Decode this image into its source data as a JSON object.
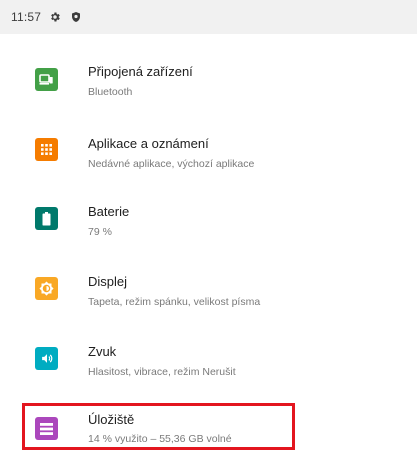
{
  "status_bar": {
    "time": "11:57",
    "icons": [
      "gear-icon",
      "shield-icon"
    ]
  },
  "settings": {
    "items": [
      {
        "title": "Připojená zařízení",
        "subtitle": "Bluetooth",
        "icon": "connected-devices-icon",
        "color": "#43a047"
      },
      {
        "title": "Aplikace a oznámení",
        "subtitle": "Nedávné aplikace, výchozí aplikace",
        "icon": "apps-grid-icon",
        "color": "#f57c00"
      },
      {
        "title": "Baterie",
        "subtitle": "79 %",
        "icon": "battery-icon",
        "color": "#00796b"
      },
      {
        "title": "Displej",
        "subtitle": "Tapeta, režim spánku, velikost písma",
        "icon": "brightness-icon",
        "color": "#f9a825"
      },
      {
        "title": "Zvuk",
        "subtitle": "Hlasitost, vibrace, režim Nerušit",
        "icon": "volume-icon",
        "color": "#00acc1"
      },
      {
        "title": "Úložiště",
        "subtitle": "14 % využito – 55,36 GB volné",
        "icon": "storage-icon",
        "color": "#ab47bc"
      }
    ]
  },
  "annotation": {
    "highlight_color": "#e3161f"
  }
}
